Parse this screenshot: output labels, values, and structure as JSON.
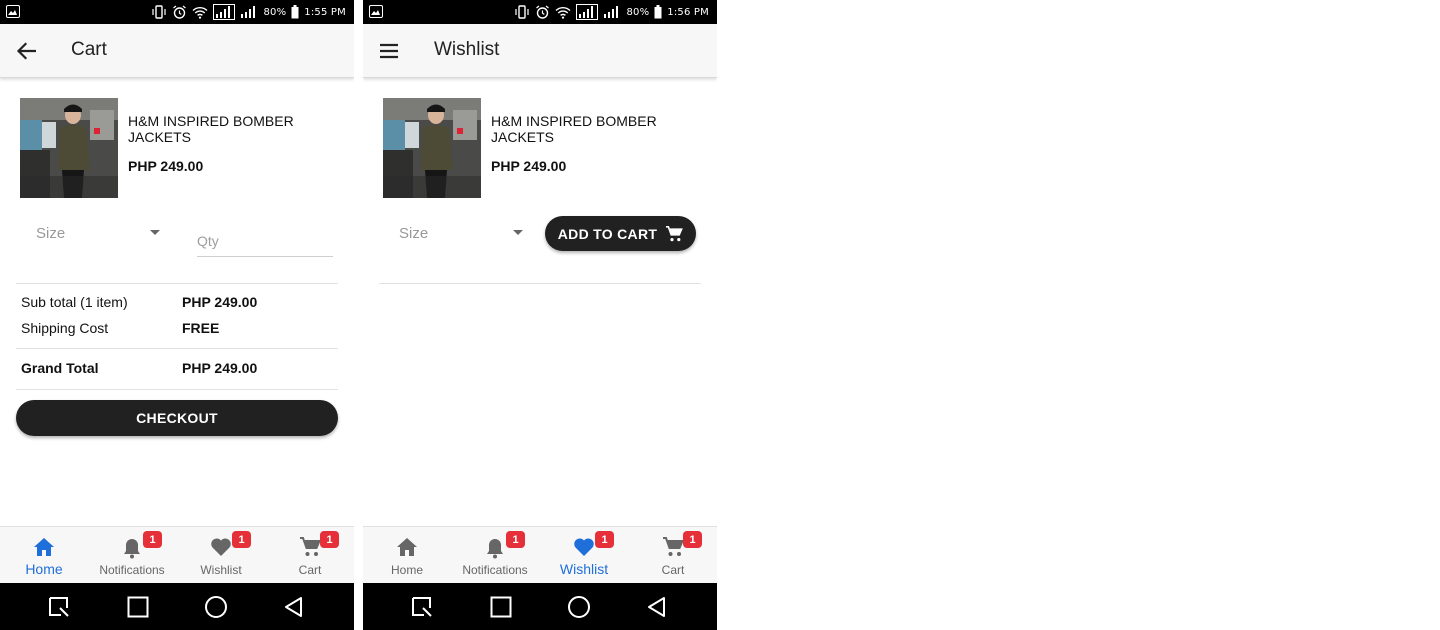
{
  "status_bar": {
    "cart_screen": {
      "battery": "80%",
      "time": "1:55 PM"
    },
    "wishlist_screen": {
      "battery": "80%",
      "time": "1:56 PM"
    }
  },
  "cart_screen": {
    "title": "Cart",
    "nav_icon": "arrow-back-icon",
    "product": {
      "name": "H&M INSPIRED BOMBER JACKETS",
      "price": "PHP 249.00"
    },
    "size_label": "Size",
    "qty_placeholder": "Qty",
    "summary": {
      "subtotal_label": "Sub total (1 item)",
      "subtotal_value": "PHP 249.00",
      "shipping_label": "Shipping Cost",
      "shipping_value": "FREE",
      "grand_total_label": "Grand Total",
      "grand_total_value": "PHP 249.00"
    },
    "checkout_label": "CHECKOUT"
  },
  "wishlist_screen": {
    "title": "Wishlist",
    "nav_icon": "menu-icon",
    "product": {
      "name": "H&M INSPIRED BOMBER JACKETS",
      "price": "PHP 249.00"
    },
    "size_label": "Size",
    "add_to_cart_label": "ADD TO CART"
  },
  "bottom_nav": {
    "cart_screen": [
      {
        "label": "Home",
        "icon": "home-icon",
        "badge": "",
        "active": true
      },
      {
        "label": "Notifications",
        "icon": "bell-icon",
        "badge": "1",
        "active": false
      },
      {
        "label": "Wishlist",
        "icon": "heart-icon",
        "badge": "1",
        "active": false
      },
      {
        "label": "Cart",
        "icon": "cart-icon",
        "badge": "1",
        "active": false
      }
    ],
    "wishlist_screen": [
      {
        "label": "Home",
        "icon": "home-icon",
        "badge": "",
        "active": false
      },
      {
        "label": "Notifications",
        "icon": "bell-icon",
        "badge": "1",
        "active": false
      },
      {
        "label": "Wishlist",
        "icon": "heart-icon",
        "badge": "1",
        "active": true
      },
      {
        "label": "Cart",
        "icon": "cart-icon",
        "badge": "1",
        "active": false
      }
    ]
  },
  "colors": {
    "accent": "#1e6fd9",
    "badge": "#e5303a",
    "button_dark": "#212121",
    "app_bar": "#f7f7f7"
  }
}
